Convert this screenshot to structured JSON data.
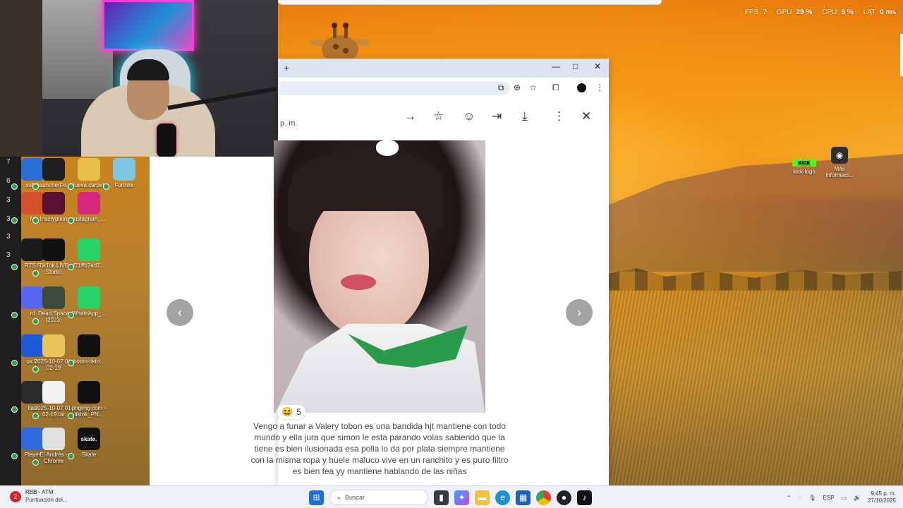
{
  "perf": [
    {
      "key": "FPS",
      "value": "7"
    },
    {
      "key": "GPU",
      "value": "29 %"
    },
    {
      "key": "CPU",
      "value": "6 %"
    },
    {
      "key": "LAT",
      "value": "0 ms"
    }
  ],
  "left_numbers": [
    "7",
    "6",
    "3",
    "3",
    "3",
    "3"
  ],
  "desktop_icons": [
    {
      "label": "soft\ne",
      "glyph": "",
      "color": "#2a6fd6"
    },
    {
      "label": "LauncherFe...",
      "glyph": "",
      "color": "#1f1f1f"
    },
    {
      "label": "Nueva carpeta",
      "glyph": "",
      "color": "#e7c04a"
    },
    {
      "label": "Fortnite",
      "glyph": "",
      "color": "#7ec8e3"
    },
    {
      "label": "M",
      "glyph": "",
      "color": "#d4502a"
    },
    {
      "label": "Inscryption",
      "glyph": "",
      "color": "#5a1030"
    },
    {
      "label": "Instagram_...",
      "glyph": "",
      "color": "#d6287b"
    },
    {
      "label": "RTS\n5",
      "glyph": "",
      "color": "#1a1a1a"
    },
    {
      "label": "TikTok LIVE Studio",
      "glyph": "",
      "color": "#111111"
    },
    {
      "label": "f71ffb7ad7...",
      "glyph": "",
      "color": "#25d366"
    },
    {
      "label": "rd",
      "glyph": "",
      "color": "#5865f2"
    },
    {
      "label": "Dead Space (2023)",
      "glyph": "",
      "color": "#3b4a3a"
    },
    {
      "label": "WhatsApp_...",
      "glyph": "",
      "color": "#25d366"
    },
    {
      "label": "ox\nio",
      "glyph": "",
      "color": "#1e5ad6"
    },
    {
      "label": "2025-10-07 01-02-19",
      "glyph": "",
      "color": "#e9c45a"
    },
    {
      "label": "boton-tikto...",
      "glyph": "",
      "color": "#111111"
    },
    {
      "label": "itan",
      "glyph": "",
      "color": "#2a2a2a"
    },
    {
      "label": "2025-10-07 01-02-19.tar",
      "glyph": "",
      "color": "#f2f2f2"
    },
    {
      "label": "pngimg.com - tiktok_PN...",
      "glyph": "",
      "color": "#111111"
    },
    {
      "label": "Player",
      "glyph": "",
      "color": "#2f6ae0"
    },
    {
      "label": "El Andrés - Chrome",
      "glyph": "",
      "color": "#e0e0e0"
    },
    {
      "label": "Skate",
      "glyph": "skate.",
      "color": "#111111"
    }
  ],
  "right_icons": [
    {
      "label": "kick-logo",
      "glyph": "KICK",
      "color": "#53fc18"
    },
    {
      "label": "Más informaci...",
      "glyph": "◉",
      "color": "#333333"
    }
  ],
  "browser": {
    "new_tab": "+",
    "minimize": "—",
    "maximize": "□",
    "close": "✕"
  },
  "viewer": {
    "time_suffix": "p. m.",
    "reaction_emoji": "😆",
    "reaction_count": "5",
    "caption": "Vengo a funar a Valery  tobon es una bandida hjt  mantiene con todo mundo y ella jura que simon le esta parando volas sabiendo que la tiene es bien ilusionada esa polla lo da por plata siempre mantiene con la misma ropa y huele maluco vive en un ranchito y es puro filtro es bien fea yy mantiene hablando de las niñas",
    "prev": "‹",
    "next": "›"
  },
  "taskbar": {
    "app_badge": "2",
    "app_title": "RBB - ATM",
    "app_sub": "Puntuación del...",
    "search_placeholder": "Buscar",
    "lang": "ESP",
    "time": "9:45 p. m.",
    "date": "27/10/2025"
  }
}
